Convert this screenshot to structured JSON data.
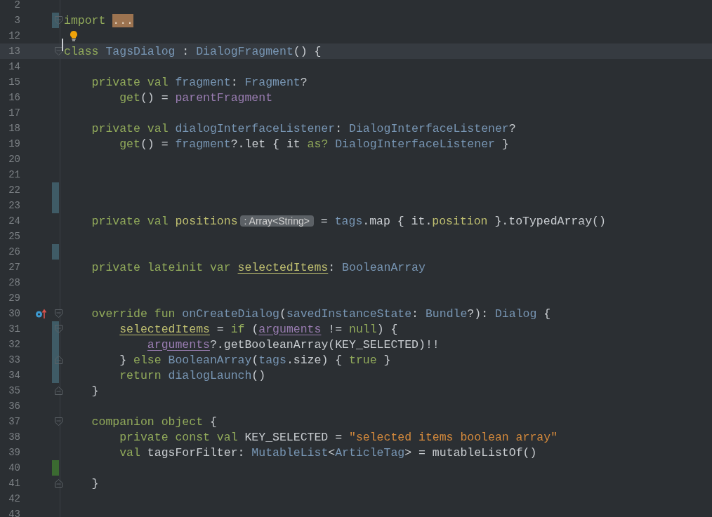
{
  "editor": {
    "lines": [
      {
        "number": "2",
        "current": false
      },
      {
        "number": "3",
        "current": false,
        "color": "#3f5b66",
        "fold_start": true,
        "tokens": [
          {
            "kind": "kw",
            "text": "import "
          },
          {
            "kind": "folded",
            "text": "..."
          }
        ]
      },
      {
        "number": "12",
        "current": false,
        "kind": "intention"
      },
      {
        "number": "13",
        "current": true,
        "fold_start": true,
        "tokens": [
          {
            "kind": "kw",
            "text": "class "
          },
          {
            "kind": "type",
            "text": "TagsDialog"
          },
          {
            "kind": "plain",
            "text": " : "
          },
          {
            "kind": "type",
            "text": "DialogFragment"
          },
          {
            "kind": "plain",
            "text": "() {"
          }
        ]
      },
      {
        "number": "14",
        "current": false
      },
      {
        "number": "15",
        "current": false,
        "tokens": [
          {
            "kind": "kw",
            "text": "    private val "
          },
          {
            "kind": "type",
            "text": "fragment"
          },
          {
            "kind": "plain",
            "text": ": "
          },
          {
            "kind": "type",
            "text": "Fragment"
          },
          {
            "kind": "plain",
            "text": "?"
          }
        ]
      },
      {
        "number": "16",
        "current": false,
        "tokens": [
          {
            "kind": "kw",
            "text": "        get"
          },
          {
            "kind": "plain",
            "text": "() = "
          },
          {
            "kind": "synthetic",
            "text": "parentFragment"
          }
        ]
      },
      {
        "number": "17",
        "current": false
      },
      {
        "number": "18",
        "current": false,
        "tokens": [
          {
            "kind": "kw",
            "text": "    private val "
          },
          {
            "kind": "type",
            "text": "dialogInterfaceListener"
          },
          {
            "kind": "plain",
            "text": ": "
          },
          {
            "kind": "type",
            "text": "DialogInterfaceListener"
          },
          {
            "kind": "plain",
            "text": "?"
          }
        ]
      },
      {
        "number": "19",
        "current": false,
        "tokens": [
          {
            "kind": "kw",
            "text": "        get"
          },
          {
            "kind": "plain",
            "text": "() = "
          },
          {
            "kind": "type",
            "text": "fragment"
          },
          {
            "kind": "plain",
            "text": "?.let { it "
          },
          {
            "kind": "kw",
            "text": "as? "
          },
          {
            "kind": "type",
            "text": "DialogInterfaceListener"
          },
          {
            "kind": "plain",
            "text": " }"
          }
        ]
      },
      {
        "number": "20",
        "current": false
      },
      {
        "number": "21",
        "current": false
      },
      {
        "number": "22",
        "current": false,
        "color": "#3f5b66"
      },
      {
        "number": "23",
        "current": false,
        "color": "#3f5b66"
      },
      {
        "number": "24",
        "current": false,
        "tokens": [
          {
            "kind": "kw",
            "text": "    private val "
          },
          {
            "kind": "field",
            "text": "positions"
          },
          {
            "kind": "hint",
            "text": ": Array<String>"
          },
          {
            "kind": "plain",
            "text": " = "
          },
          {
            "kind": "type",
            "text": "tags"
          },
          {
            "kind": "plain",
            "text": ".map { it."
          },
          {
            "kind": "field",
            "text": "position"
          },
          {
            "kind": "plain",
            "text": " }.toTypedArray()"
          }
        ]
      },
      {
        "number": "25",
        "current": false
      },
      {
        "number": "26",
        "current": false,
        "color": "#3f5b66"
      },
      {
        "number": "27",
        "current": false,
        "tokens": [
          {
            "kind": "kw",
            "text": "    private lateinit var "
          },
          {
            "kind": "mutable",
            "text": "selectedItems"
          },
          {
            "kind": "plain",
            "text": ": "
          },
          {
            "kind": "type",
            "text": "BooleanArray"
          }
        ]
      },
      {
        "number": "28",
        "current": false
      },
      {
        "number": "29",
        "current": false
      },
      {
        "number": "30",
        "current": false,
        "kind": "override",
        "fold_start": true,
        "tokens": [
          {
            "kind": "kw",
            "text": "    override fun "
          },
          {
            "kind": "type",
            "text": "onCreateDialog"
          },
          {
            "kind": "plain",
            "text": "("
          },
          {
            "kind": "type",
            "text": "savedInstanceState"
          },
          {
            "kind": "plain",
            "text": ": "
          },
          {
            "kind": "type",
            "text": "Bundle"
          },
          {
            "kind": "plain",
            "text": "?): "
          },
          {
            "kind": "type",
            "text": "Dialog"
          },
          {
            "kind": "plain",
            "text": " {"
          }
        ]
      },
      {
        "number": "31",
        "current": false,
        "color": "#3f5b66",
        "fold_start": true,
        "tokens": [
          {
            "kind": "mutable",
            "text": "        selectedItems"
          },
          {
            "kind": "plain",
            "text": " = "
          },
          {
            "kind": "kw",
            "text": "if "
          },
          {
            "kind": "plain",
            "text": "("
          },
          {
            "kind": "synthetic-u",
            "text": "arguments"
          },
          {
            "kind": "plain",
            "text": " != "
          },
          {
            "kind": "kw",
            "text": "null"
          },
          {
            "kind": "plain",
            "text": ") {"
          }
        ]
      },
      {
        "number": "32",
        "current": false,
        "color": "#3f5b66",
        "tokens": [
          {
            "kind": "synthetic-u",
            "text": "            arguments"
          },
          {
            "kind": "plain",
            "text": "?.getBooleanArray(KEY_SELECTED)!!"
          }
        ]
      },
      {
        "number": "33",
        "current": false,
        "color": "#3f5b66",
        "fold_end": true,
        "tokens": [
          {
            "kind": "plain",
            "text": "        } "
          },
          {
            "kind": "kw",
            "text": "else "
          },
          {
            "kind": "type",
            "text": "BooleanArray"
          },
          {
            "kind": "plain",
            "text": "("
          },
          {
            "kind": "type",
            "text": "tags"
          },
          {
            "kind": "plain",
            "text": ".size) { "
          },
          {
            "kind": "kw",
            "text": "true"
          },
          {
            "kind": "plain",
            "text": " }"
          }
        ]
      },
      {
        "number": "34",
        "current": false,
        "color": "#3f5b66",
        "tokens": [
          {
            "kind": "kw",
            "text": "        return "
          },
          {
            "kind": "type",
            "text": "dialogLaunch"
          },
          {
            "kind": "plain",
            "text": "()"
          }
        ]
      },
      {
        "number": "35",
        "current": false,
        "fold_end": true,
        "tokens": [
          {
            "kind": "plain",
            "text": "    }"
          }
        ]
      },
      {
        "number": "36",
        "current": false
      },
      {
        "number": "37",
        "current": false,
        "fold_start": true,
        "tokens": [
          {
            "kind": "kw",
            "text": "    companion object "
          },
          {
            "kind": "plain",
            "text": "{"
          }
        ]
      },
      {
        "number": "38",
        "current": false,
        "tokens": [
          {
            "kind": "kw",
            "text": "        private const val "
          },
          {
            "kind": "plain",
            "text": "KEY_SELECTED = "
          },
          {
            "kind": "str",
            "text": "\"selected items boolean array\""
          }
        ]
      },
      {
        "number": "39",
        "current": false,
        "tokens": [
          {
            "kind": "kw",
            "text": "        val "
          },
          {
            "kind": "plain",
            "text": "tagsForFilter: "
          },
          {
            "kind": "type",
            "text": "MutableList"
          },
          {
            "kind": "plain",
            "text": "<"
          },
          {
            "kind": "type",
            "text": "ArticleTag"
          },
          {
            "kind": "plain",
            "text": "> = mutableListOf()"
          }
        ]
      },
      {
        "number": "40",
        "current": false,
        "color": "#3b6a31"
      },
      {
        "number": "41",
        "current": false,
        "fold_end": true,
        "tokens": [
          {
            "kind": "plain",
            "text": "    }"
          }
        ]
      },
      {
        "number": "42",
        "current": false
      },
      {
        "number": "43",
        "current": false
      }
    ]
  }
}
